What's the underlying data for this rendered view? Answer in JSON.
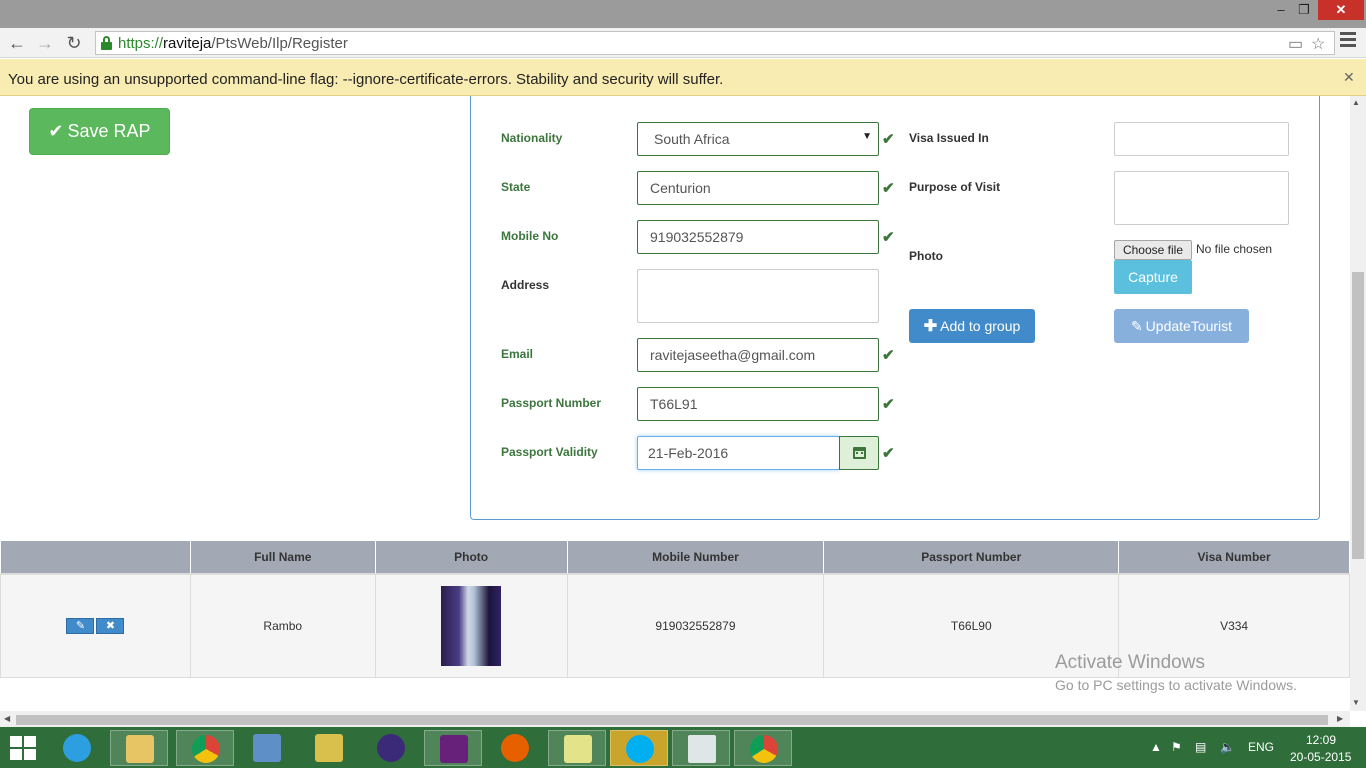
{
  "browser": {
    "url_scheme": "https://",
    "url_host": "raviteja",
    "url_path": "/PtsWeb/Ilp/Register",
    "infobar_text": "You are using an unsupported command-line flag: --ignore-certificate-errors. Stability and security will suffer."
  },
  "actions": {
    "save_label": "Save RAP",
    "add_group_label": "Add to group",
    "update_label": "UpdateTourist",
    "capture_label": "Capture",
    "choose_file_label": "Choose file",
    "no_file_text": "No file chosen"
  },
  "form": {
    "nationality_label": "Nationality",
    "nationality_value": "South Africa",
    "state_label": "State",
    "state_value": "Centurion",
    "mobile_label": "Mobile No",
    "mobile_value": "919032552879",
    "address_label": "Address",
    "address_value": "",
    "email_label": "Email",
    "email_value": "ravitejaseetha@gmail.com",
    "passport_number_label": "Passport Number",
    "passport_number_value": "T66L91",
    "passport_validity_label": "Passport Validity",
    "passport_validity_value": "21-Feb-2016",
    "visa_issued_label": "Visa Issued In",
    "visa_issued_value": "",
    "purpose_label": "Purpose of Visit",
    "purpose_value": "",
    "photo_label": "Photo"
  },
  "table": {
    "headers": [
      "",
      "Full Name",
      "Photo",
      "Mobile Number",
      "Passport Number",
      "Visa Number"
    ],
    "rows": [
      {
        "full_name": "Rambo",
        "mobile": "919032552879",
        "passport": "T66L90",
        "visa": "V334"
      }
    ]
  },
  "watermark": {
    "title": "Activate Windows",
    "subtitle": "Go to PC settings to activate Windows."
  },
  "taskbar": {
    "language": "ENG",
    "time": "12:09",
    "date": "20-05-2015",
    "apps": [
      "internet-explorer",
      "file-explorer",
      "chrome",
      "network-app",
      "tools-app",
      "eclipse",
      "visual-studio",
      "firefox",
      "notes-app",
      "skype",
      "document-app",
      "chrome"
    ]
  },
  "colors": {
    "success": "#5cb85c",
    "primary": "#428bca",
    "info": "#5bc0de",
    "valid_green": "#3c763d",
    "infobar_yellow": "#f9ecb2",
    "taskbar_green": "#2f6e3a"
  }
}
